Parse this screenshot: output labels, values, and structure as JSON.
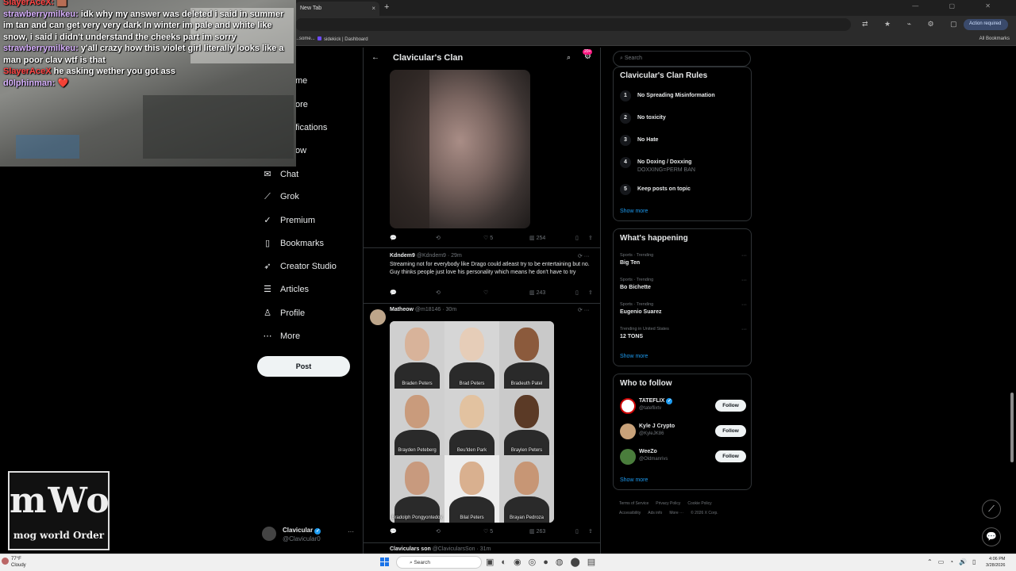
{
  "browser": {
    "tab_title": "New Tab",
    "tab_close": "×",
    "new_tab": "+",
    "window_controls": "— ▢ ✕",
    "toolbar_icons": "⇄ ★ ⌁ ⚙ ▢ ◉",
    "action_required": "Action required",
    "bookmarks": [
      {
        "label": "...some..."
      },
      {
        "label": "sidekick | Dashboard"
      }
    ],
    "all_bookmarks": "All Bookmarks"
  },
  "overlay": {
    "chat": [
      {
        "user": "SlayerAceX:",
        "user_color": "red",
        "text": " 🟫"
      },
      {
        "user": "strawberrymilkeu:",
        "user_color": "purple",
        "text": " idk why my answer was deleted i said in summer im tan and can get very very dark In winter im pale and white like snow, i said i didn't understand the cheeks part im sorry"
      },
      {
        "user": "strawberrymilkeu:",
        "user_color": "purple",
        "text": " y'all crazy how this violet girl literally looks like a man poor clav wtf is that"
      },
      {
        "user": "SlayerAceX",
        "user_color": "red",
        "text": " he asking wether you got ass"
      },
      {
        "user": "d0lphinman:",
        "user_color": "purple",
        "text": " ❤️"
      }
    ],
    "logo_big": "mWo",
    "logo_small": "mog world Order"
  },
  "nav": {
    "partial_items": [
      "me",
      "ore",
      "fications",
      "ow"
    ],
    "items": [
      {
        "label": "Chat",
        "icon": "✉",
        "icon_name": "chat-icon"
      },
      {
        "label": "Grok",
        "icon": "⟋",
        "icon_name": "grok-icon"
      },
      {
        "label": "Premium",
        "icon": "✓",
        "icon_name": "premium-icon"
      },
      {
        "label": "Bookmarks",
        "icon": "▯",
        "icon_name": "bookmark-icon"
      },
      {
        "label": "Creator Studio",
        "icon": "➶",
        "icon_name": "creator-studio-icon"
      },
      {
        "label": "Articles",
        "icon": "☰",
        "icon_name": "articles-icon"
      },
      {
        "label": "Profile",
        "icon": "♙",
        "icon_name": "profile-icon"
      },
      {
        "label": "More",
        "icon": "⋯",
        "icon_name": "more-icon"
      }
    ],
    "post_button": "Post",
    "account": {
      "name": "Clavicular",
      "handle": "@Clavicular0",
      "more": "···"
    }
  },
  "community": {
    "title": "Clavicular's Clan",
    "badge": "20+",
    "posts": [
      {
        "replies": "",
        "reposts": "",
        "likes": "5",
        "views": "254"
      },
      {
        "author": "Kdndem9",
        "handle": "@Kdndem9 · 29m",
        "text": "Streaming not for everybody like Drago could atleast try to be entertaining but no. Guy thinks people just love his personality which means he don't have to try",
        "likes": "",
        "views": "243"
      },
      {
        "author": "Matheow",
        "handle": "@m18146 · 30m",
        "captions": [
          "Braden Peters",
          "Brad Peters",
          "Bradeuth Patel",
          "Brayden Peteberg",
          "Beu'lden Park",
          "Braylen Peters",
          "Bradolph Pongyontedov",
          "Bilal Peters",
          "Brayan Pedroza"
        ],
        "likes": "5",
        "views": "263"
      },
      {
        "author": "Claviculars son",
        "handle": "@ClavicularsSon · 31m"
      }
    ]
  },
  "right": {
    "search_placeholder": "Search",
    "rules_title": "Clavicular's Clan Rules",
    "rules": [
      {
        "num": "1",
        "text": "No Spreading Misinformation",
        "sub": ""
      },
      {
        "num": "2",
        "text": "No toxicity",
        "sub": ""
      },
      {
        "num": "3",
        "text": "No Hate",
        "sub": ""
      },
      {
        "num": "4",
        "text": "No Doxing / Doxxing",
        "sub": "DOXXING=PERM BAN"
      },
      {
        "num": "5",
        "text": "Keep posts on topic",
        "sub": ""
      }
    ],
    "show_more": "Show more",
    "happening_title": "What's happening",
    "trends": [
      {
        "context": "Sports · Trending",
        "name": "Big Ten"
      },
      {
        "context": "Sports · Trending",
        "name": "Bo Bichette"
      },
      {
        "context": "Sports · Trending",
        "name": "Eugenio Suarez"
      },
      {
        "context": "Trending in United States",
        "name": "12 TONS"
      }
    ],
    "wtf_title": "Who to follow",
    "follow_label": "Follow",
    "who_to_follow": [
      {
        "name": "TATEFLIX",
        "handle": "@tateflixtv",
        "color": "#ffffff"
      },
      {
        "name": "Kyle J Crypto",
        "handle": "@KyleJK86",
        "color": "#c9a27a"
      },
      {
        "name": "WeeZo",
        "handle": "@Oldmanrivs",
        "color": "#4a7d3c"
      }
    ],
    "footer": [
      "Terms of Service",
      "Privacy Policy",
      "Cookie Policy",
      "Accessibility",
      "Ads info",
      "More ···",
      "© 2026 X Corp."
    ]
  },
  "taskbar": {
    "temp": "77°F",
    "weather": "Cloudy",
    "search": "Search",
    "time": "4:06 PM",
    "date": "3/28/2026"
  }
}
